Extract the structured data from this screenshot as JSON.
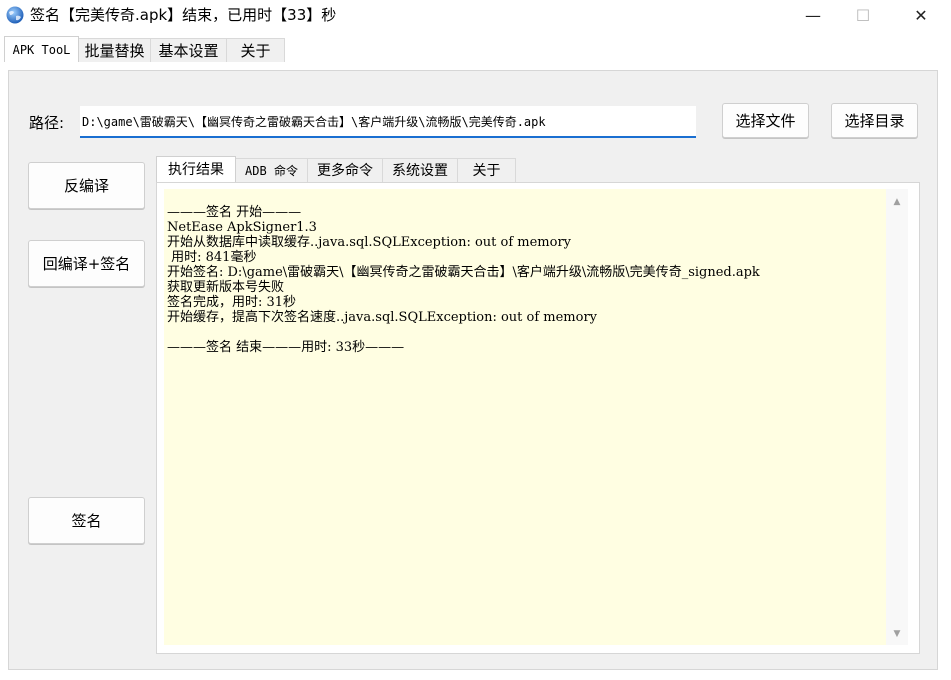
{
  "window": {
    "title": "签名【完美传奇.apk】结束，已用时【33】秒",
    "minimize_glyph": "—",
    "maximize_glyph": "☐",
    "close_glyph": "✕",
    "icon": "globe-icon"
  },
  "outer_tabs": [
    {
      "label": "APK TooL",
      "active": true
    },
    {
      "label": "批量替换",
      "active": false
    },
    {
      "label": "基本设置",
      "active": false
    },
    {
      "label": "关于",
      "active": false
    }
  ],
  "path": {
    "label": "路径:",
    "value": "D:\\game\\雷破霸天\\【幽冥传奇之雷破霸天合击】\\客户端升级\\流畅版\\完美传奇.apk"
  },
  "buttons": {
    "choose_file": "选择文件",
    "choose_dir": "选择目录",
    "decompile": "反编译",
    "recompile_sign": "回编译+签名",
    "sign": "签名"
  },
  "inner_tabs": [
    {
      "label": "执行结果",
      "active": true
    },
    {
      "label": "ADB 命令",
      "active": false
    },
    {
      "label": "更多命令",
      "active": false
    },
    {
      "label": "系统设置",
      "active": false
    },
    {
      "label": "关于",
      "active": false
    }
  ],
  "output": {
    "lines": [
      "———签名 开始———",
      "NetEase ApkSigner1.3",
      "开始从数据库中读取缓存..java.sql.SQLException: out of memory",
      " 用时: 841毫秒",
      "开始签名: D:\\game\\雷破霸天\\【幽冥传奇之雷破霸天合击】\\客户端升级\\流畅版\\完美传奇_signed.apk",
      "获取更新版本号失败",
      "签名完成，用时: 31秒",
      "开始缓存，提高下次签名速度..java.sql.SQLException: out of memory",
      "",
      "———签名 结束———用时: 33秒———"
    ]
  },
  "colors": {
    "output_background": "#fffee2",
    "input_focus_underline": "#1a6fd1",
    "panel_background": "#f0f0f0"
  }
}
